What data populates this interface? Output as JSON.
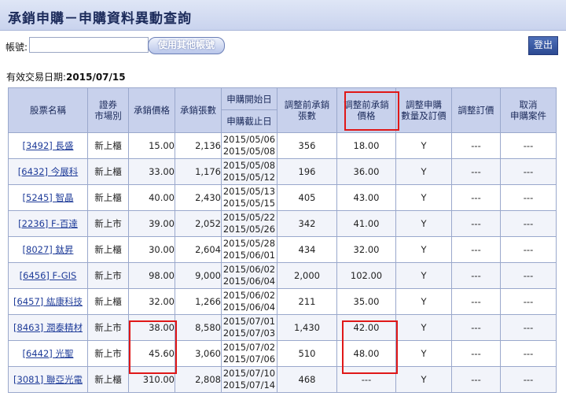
{
  "title": "承銷申購－申購資料異動查詢",
  "account": {
    "label": "帳號:",
    "value": "",
    "other_button": "使用其他帳號"
  },
  "logout_label": "登出",
  "effective_date": {
    "label": "有效交易日期:",
    "value": "2015/07/15"
  },
  "table": {
    "headers": {
      "name": "股票名稱",
      "market": "證券\n市場別",
      "price": "承銷價格",
      "shares": "承銷張數",
      "start": "申購開始日",
      "end": "申購截止日",
      "pre_shares": "調整前承銷\n張數",
      "pre_price": "調整前承銷\n價格",
      "adjust": "調整申購\n數量及訂價",
      "adjust_price": "調整訂價",
      "cancel": "取消\n申購案件"
    },
    "rows": [
      {
        "name": "[3492] 長盛",
        "market": "新上櫃",
        "price": "15.00",
        "shares": "2,136",
        "start": "2015/05/06",
        "end": "2015/05/08",
        "pre_shares": "356",
        "pre_price": "18.00",
        "adjust": "Y",
        "adjust_price": "---",
        "cancel": "---"
      },
      {
        "name": "[6432] 今展科",
        "market": "新上櫃",
        "price": "33.00",
        "shares": "1,176",
        "start": "2015/05/08",
        "end": "2015/05/12",
        "pre_shares": "196",
        "pre_price": "36.00",
        "adjust": "Y",
        "adjust_price": "---",
        "cancel": "---"
      },
      {
        "name": "[5245] 智晶",
        "market": "新上櫃",
        "price": "40.00",
        "shares": "2,430",
        "start": "2015/05/13",
        "end": "2015/05/15",
        "pre_shares": "405",
        "pre_price": "43.00",
        "adjust": "Y",
        "adjust_price": "---",
        "cancel": "---"
      },
      {
        "name": "[2236] F-百達",
        "market": "新上市",
        "price": "39.00",
        "shares": "2,052",
        "start": "2015/05/22",
        "end": "2015/05/26",
        "pre_shares": "342",
        "pre_price": "41.00",
        "adjust": "Y",
        "adjust_price": "---",
        "cancel": "---"
      },
      {
        "name": "[8027] 鈦昇",
        "market": "新上櫃",
        "price": "30.00",
        "shares": "2,604",
        "start": "2015/05/28",
        "end": "2015/06/01",
        "pre_shares": "434",
        "pre_price": "32.00",
        "adjust": "Y",
        "adjust_price": "---",
        "cancel": "---"
      },
      {
        "name": "[6456] F-GIS",
        "market": "新上市",
        "price": "98.00",
        "shares": "9,000",
        "start": "2015/06/02",
        "end": "2015/06/04",
        "pre_shares": "2,000",
        "pre_price": "102.00",
        "adjust": "Y",
        "adjust_price": "---",
        "cancel": "---"
      },
      {
        "name": "[6457] 紘康科技",
        "market": "新上櫃",
        "price": "32.00",
        "shares": "1,266",
        "start": "2015/06/02",
        "end": "2015/06/04",
        "pre_shares": "211",
        "pre_price": "35.00",
        "adjust": "Y",
        "adjust_price": "---",
        "cancel": "---"
      },
      {
        "name": "[8463] 潤泰精材",
        "market": "新上市",
        "price": "38.00",
        "shares": "8,580",
        "start": "2015/07/01",
        "end": "2015/07/03",
        "pre_shares": "1,430",
        "pre_price": "42.00",
        "adjust": "Y",
        "adjust_price": "---",
        "cancel": "---"
      },
      {
        "name": "[6442] 光聖",
        "market": "新上市",
        "price": "45.60",
        "shares": "3,060",
        "start": "2015/07/02",
        "end": "2015/07/06",
        "pre_shares": "510",
        "pre_price": "48.00",
        "adjust": "Y",
        "adjust_price": "---",
        "cancel": "---"
      },
      {
        "name": "[3081] 聯亞光電",
        "market": "新上櫃",
        "price": "310.00",
        "shares": "2,808",
        "start": "2015/07/10",
        "end": "2015/07/14",
        "pre_shares": "468",
        "pre_price": "---",
        "adjust": "Y",
        "adjust_price": "---",
        "cancel": "---"
      }
    ]
  },
  "colors": {
    "header_bg": "#c8d1ec",
    "highlight": "#e01818",
    "link": "#1f3c99"
  }
}
